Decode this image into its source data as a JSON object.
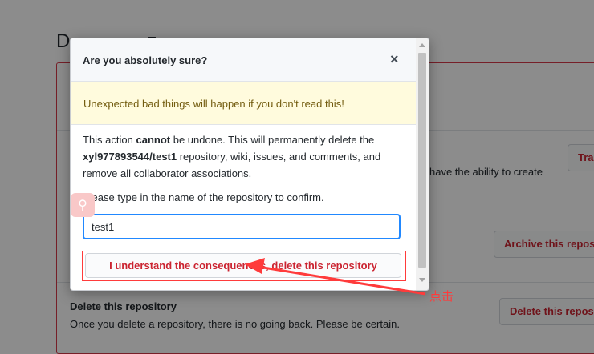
{
  "background": {
    "title_fragment_left": "D",
    "title_fragment_right": "z",
    "row2_right_text": "have the ability to create",
    "transfer_button_label": "Tra",
    "archive_button_label": "Archive this repos",
    "delete_section_title": "Delete this repository",
    "delete_section_desc": "Once you delete a repository, there is no going back. Please be certain.",
    "delete_button_label": "Delete this repos"
  },
  "modal": {
    "title": "Are you absolutely sure?",
    "close_glyph": "×",
    "warning": "Unexpected bad things will happen if you don't read this!",
    "body_prefix": "This action ",
    "body_bold_cannot": "cannot",
    "body_middle": " be undone. This will permanently delete the ",
    "repo_name": "xyl977893544/test1",
    "body_suffix": " repository, wiki, issues, and comments, and remove all collaborator associations.",
    "confirm_label": "Please type in the name of the repository to confirm.",
    "confirm_input_value": "test1",
    "confirm_button_label": "I understand the consequences, delete this repository"
  },
  "annotation": {
    "label": "点击",
    "color": "#ff3b3b"
  },
  "colors": {
    "danger": "#cb2431",
    "focus": "#2188ff",
    "warning_bg": "#fffbdd"
  }
}
